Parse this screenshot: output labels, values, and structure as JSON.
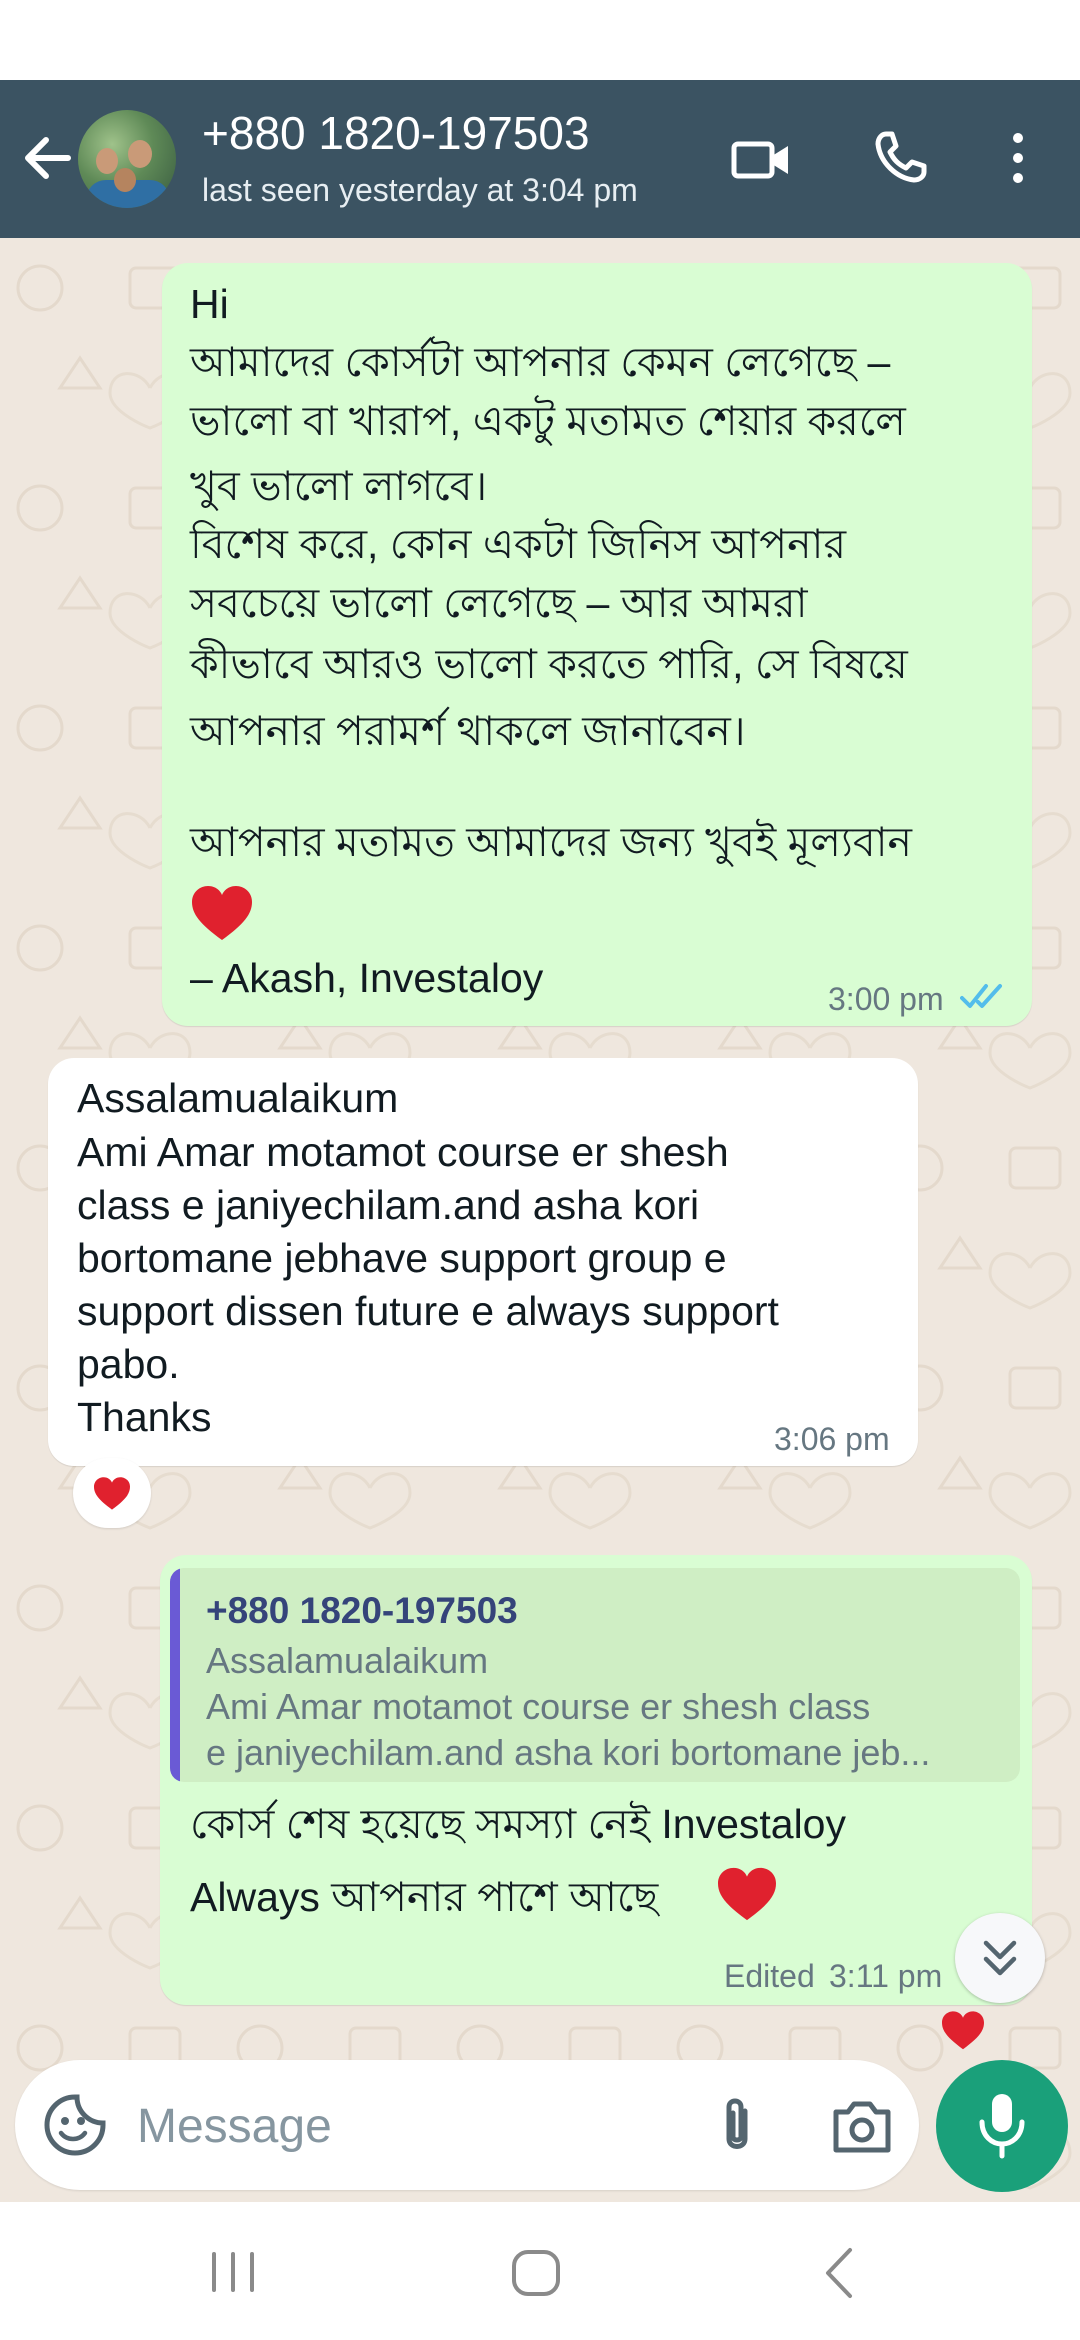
{
  "header": {
    "contact_name": "+880 1820-197503",
    "last_seen": "last seen yesterday at 3:04 pm",
    "back_icon": "arrow-left-icon",
    "video_icon": "video-camera-icon",
    "call_icon": "phone-icon",
    "menu_icon": "more-vertical-icon"
  },
  "messages": [
    {
      "direction": "outgoing",
      "lines": [
        "Hi",
        "আমাদের কোর্সটা আপনার কেমন লেগেছে –",
        "ভালো বা খারাপ, একটু মতামত শেয়ার করলে",
        "খুব ভালো লাগবে।",
        "বিশেষ করে, কোন একটা জিনিস আপনার",
        "সবচেয়ে ভালো লেগেছে – আর আমরা",
        "কীভাবে আরও ভালো করতে পারি, সে বিষয়ে",
        "আপনার পরামর্শ থাকলে জানাবেন।",
        "",
        "আপনার মতামত আমাদের জন্য খুবই মূল্যবান",
        "– Akash, Investaloy"
      ],
      "time": "3:00 pm",
      "status": "read"
    },
    {
      "direction": "incoming",
      "lines": [
        "Assalamualaikum",
        "Ami Amar motamot course er shesh",
        "class e janiyechilam.and asha kori",
        "bortomane jebhave support group e",
        "support dissen future e always support",
        "pabo.",
        "Thanks"
      ],
      "time": "3:06 pm",
      "reaction": "❤️"
    },
    {
      "direction": "outgoing",
      "quote": {
        "author": "+880 1820-197503",
        "lines": [
          "Assalamualaikum",
          "Ami Amar motamot course er shesh class",
          "e janiyechilam.and asha kori bortomane jeb..."
        ]
      },
      "lines": [
        "কোর্স শেষ হয়েছে সমস্যা নেই Investaloy",
        "Always আপনার পাশে আছে"
      ],
      "edited_label": "Edited",
      "time": "3:11 pm",
      "reaction": "❤️"
    }
  ],
  "composer": {
    "placeholder": "Message",
    "emoji_icon": "sticker-icon",
    "attach_icon": "paperclip-icon",
    "camera_icon": "camera-icon",
    "mic_icon": "microphone-icon"
  },
  "navigation": {
    "recents_icon": "recents-icon",
    "home_icon": "home-icon",
    "back_icon": "back-chevron-icon"
  },
  "colors": {
    "app_bar": "#3b5362",
    "chat_background": "#efe7de",
    "outgoing_bubble": "#d9fdd3",
    "incoming_bubble": "#ffffff",
    "read_ticks": "#53bdeb",
    "mic_button": "#1aa07a",
    "quote_bar": "#6a5ad5"
  }
}
